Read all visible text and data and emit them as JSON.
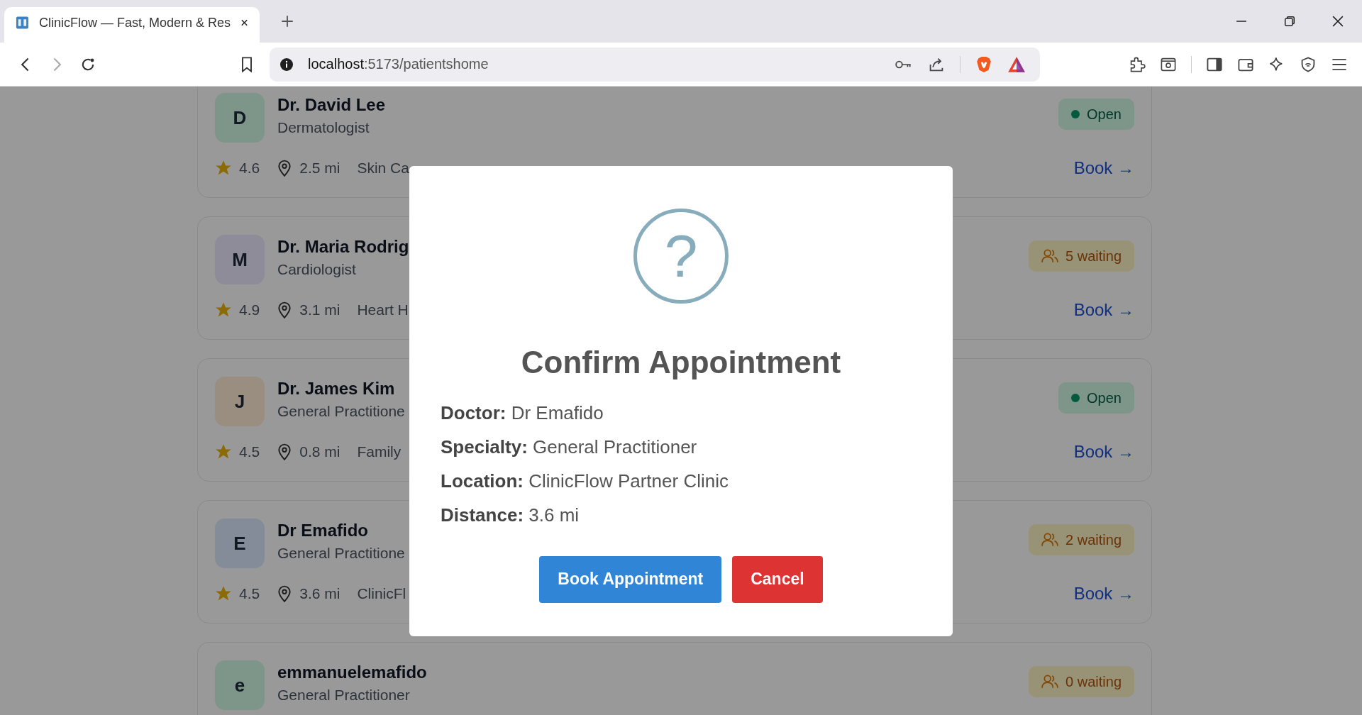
{
  "browser": {
    "tab_title": "ClinicFlow — Fast, Modern & Res",
    "url_host": "localhost",
    "url_path": ":5173/patientshome"
  },
  "doctors": [
    {
      "initial": "D",
      "color": "#7d9689",
      "name": "Dr. David Lee",
      "specialty": "Dermatologist",
      "rating": "4.6",
      "distance": "2.5 mi",
      "clinic": "Skin Ca",
      "status": {
        "kind": "open",
        "text": "Open"
      },
      "book": "Book →"
    },
    {
      "initial": "M",
      "color": "#8e8c98",
      "name": "Dr. Maria Rodrig",
      "specialty": "Cardiologist",
      "rating": "4.9",
      "distance": "3.1 mi",
      "clinic": "Heart H",
      "status": {
        "kind": "waiting",
        "text": "5 waiting"
      },
      "book": "Book →"
    },
    {
      "initial": "J",
      "color": "#998e80",
      "name": "Dr. James Kim",
      "specialty": "General Practitione",
      "rating": "4.5",
      "distance": "0.8 mi",
      "clinic": "Family",
      "status": {
        "kind": "open",
        "text": "Open"
      },
      "book": "Book →"
    },
    {
      "initial": "E",
      "color": "#838c98",
      "name": "Dr Emafido",
      "specialty": "General Practitione",
      "rating": "4.5",
      "distance": "3.6 mi",
      "clinic": "ClinicFl",
      "status": {
        "kind": "waiting",
        "text": "2 waiting"
      },
      "book": "Book →"
    },
    {
      "initial": "e",
      "color": "#7d9689",
      "name": "emmanuelemafido",
      "specialty": "General Practitioner",
      "status": {
        "kind": "waiting",
        "text": "0 waiting"
      }
    }
  ],
  "dialog": {
    "icon": "?",
    "title": "Confirm Appointment",
    "fields": [
      {
        "label": "Doctor:",
        "value": "Dr Emafido"
      },
      {
        "label": "Specialty:",
        "value": "General Practitioner"
      },
      {
        "label": "Location:",
        "value": "ClinicFlow Partner Clinic"
      },
      {
        "label": "Distance:",
        "value": "3.6 mi"
      }
    ],
    "buttons": [
      {
        "kind": "confirm",
        "label": "Book Appointment"
      },
      {
        "kind": "cancel",
        "label": "Cancel"
      }
    ]
  }
}
